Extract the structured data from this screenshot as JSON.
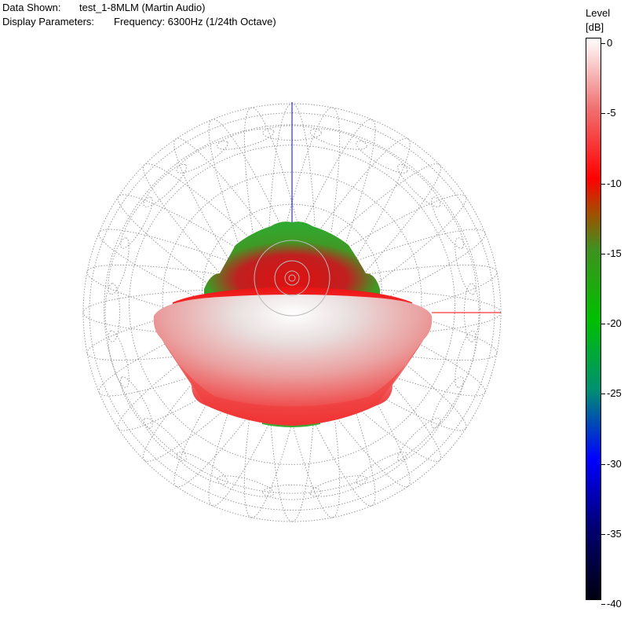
{
  "header": {
    "data_shown_label": "Data Shown:",
    "data_shown_value": "test_1-8MLM (Martin Audio)",
    "display_params_label": "Display Parameters:",
    "display_params_value": "Frequency: 6300Hz (1/24th Octave)"
  },
  "legend": {
    "title_line1": "Level",
    "title_line2": "[dB]",
    "ticks": [
      "0",
      "-5",
      "-10",
      "-15",
      "-20",
      "-25",
      "-30",
      "-35",
      "-40"
    ],
    "colors": {
      "0": "#ffffff",
      "-5": "#f07070",
      "-10": "#ff0000",
      "-12.5": "#a05000",
      "-15": "#409020",
      "-20": "#00c000",
      "-25": "#009070",
      "-30": "#0000ff",
      "-35": "#000070",
      "-40": "#000010"
    }
  },
  "chart_data": {
    "type": "heatmap",
    "plot_kind": "3D balloon directivity",
    "frequency_hz": 6300,
    "bandwidth": "1/24th Octave",
    "color_scale_db": [
      0,
      -40
    ],
    "level_range_db": {
      "min": -40,
      "max": 0
    },
    "axes": {
      "x": "red",
      "z": "blue"
    }
  }
}
